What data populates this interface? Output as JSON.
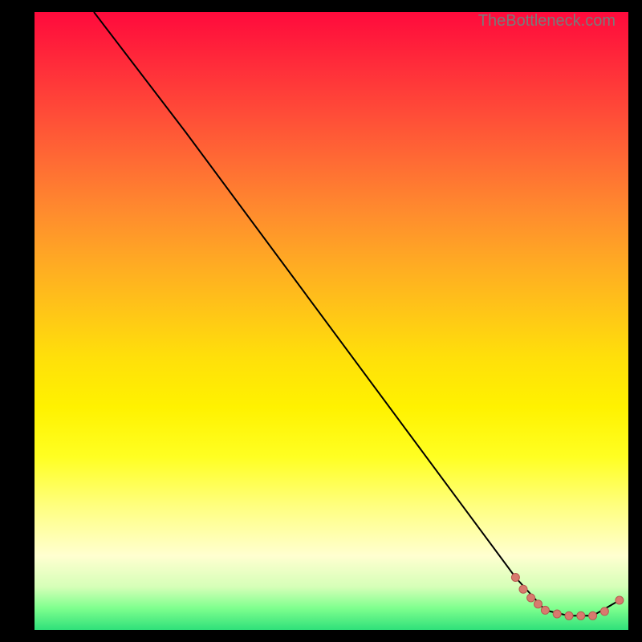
{
  "watermark": "TheBottleneck.com",
  "colors": {
    "line": "#000000",
    "marker_fill": "#d87a6e",
    "marker_stroke": "#b85a50",
    "gradient_top": "#ff0a3c",
    "gradient_mid": "#ffe00a",
    "gradient_bottom": "#2fe07a"
  },
  "chart_data": {
    "type": "line",
    "title": "",
    "xlabel": "",
    "ylabel": "",
    "xlim": [
      0,
      100
    ],
    "ylim": [
      0,
      100
    ],
    "grid": false,
    "series": [
      {
        "name": "curve",
        "x": [
          10,
          25.5,
          81,
          86,
          90,
          94,
          98.5
        ],
        "y": [
          100,
          80.5,
          8.5,
          3.2,
          2.3,
          2.3,
          4.8
        ]
      }
    ],
    "markers": {
      "name": "highlight-points",
      "x": [
        81,
        82.3,
        83.6,
        84.8,
        86,
        88,
        90,
        92,
        94,
        96,
        98.5
      ],
      "y": [
        8.5,
        6.6,
        5.2,
        4.2,
        3.2,
        2.6,
        2.3,
        2.3,
        2.3,
        3.0,
        4.8
      ]
    },
    "annotations": []
  }
}
